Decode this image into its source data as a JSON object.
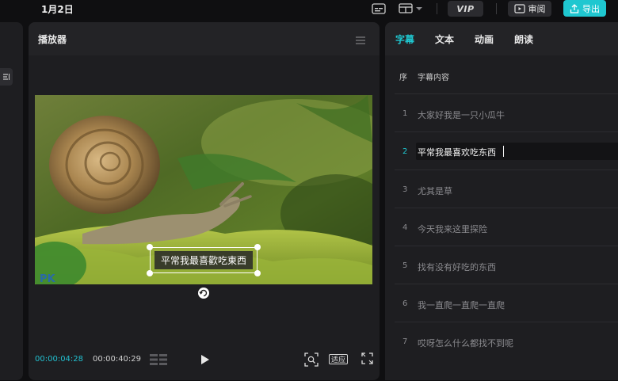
{
  "topbar": {
    "date": "1月2日",
    "vip_label": "VIP",
    "review_label": "审阅",
    "export_label": "导出"
  },
  "player": {
    "title": "播放器",
    "subtitle_overlay": "平常我最喜歡吃東西",
    "watermark": "PK",
    "current_time": "00:00:04:28",
    "total_time": "00:00:40:29",
    "fit_label": "适应"
  },
  "subtitle_panel": {
    "tabs": [
      {
        "label": "字幕",
        "active": true
      },
      {
        "label": "文本",
        "active": false
      },
      {
        "label": "动画",
        "active": false
      },
      {
        "label": "朗读",
        "active": false
      }
    ],
    "columns": {
      "index": "序",
      "content": "字幕内容"
    },
    "rows": [
      {
        "index": "1",
        "text": "大家好我是一只小瓜牛",
        "active": false
      },
      {
        "index": "2",
        "text": "平常我最喜欢吃东西",
        "active": true
      },
      {
        "index": "3",
        "text": "尤其是草",
        "active": false
      },
      {
        "index": "4",
        "text": "今天我来这里探险",
        "active": false
      },
      {
        "index": "5",
        "text": "找有没有好吃的东西",
        "active": false
      },
      {
        "index": "6",
        "text": "我一直爬一直爬一直爬",
        "active": false
      },
      {
        "index": "7",
        "text": "哎呀怎么什么都找不到呢",
        "active": false
      }
    ]
  },
  "colors": {
    "accent": "#1fc7d0",
    "panel_bg": "#1e1e21",
    "app_bg": "#0f0f11"
  },
  "icons": [
    "subtitle-icon",
    "layout-icon",
    "review-icon",
    "export-icon",
    "menu-icon",
    "rotate-icon",
    "grid-icon",
    "play-icon",
    "fit-frame-icon",
    "fullscreen-icon",
    "filter-icon"
  ]
}
